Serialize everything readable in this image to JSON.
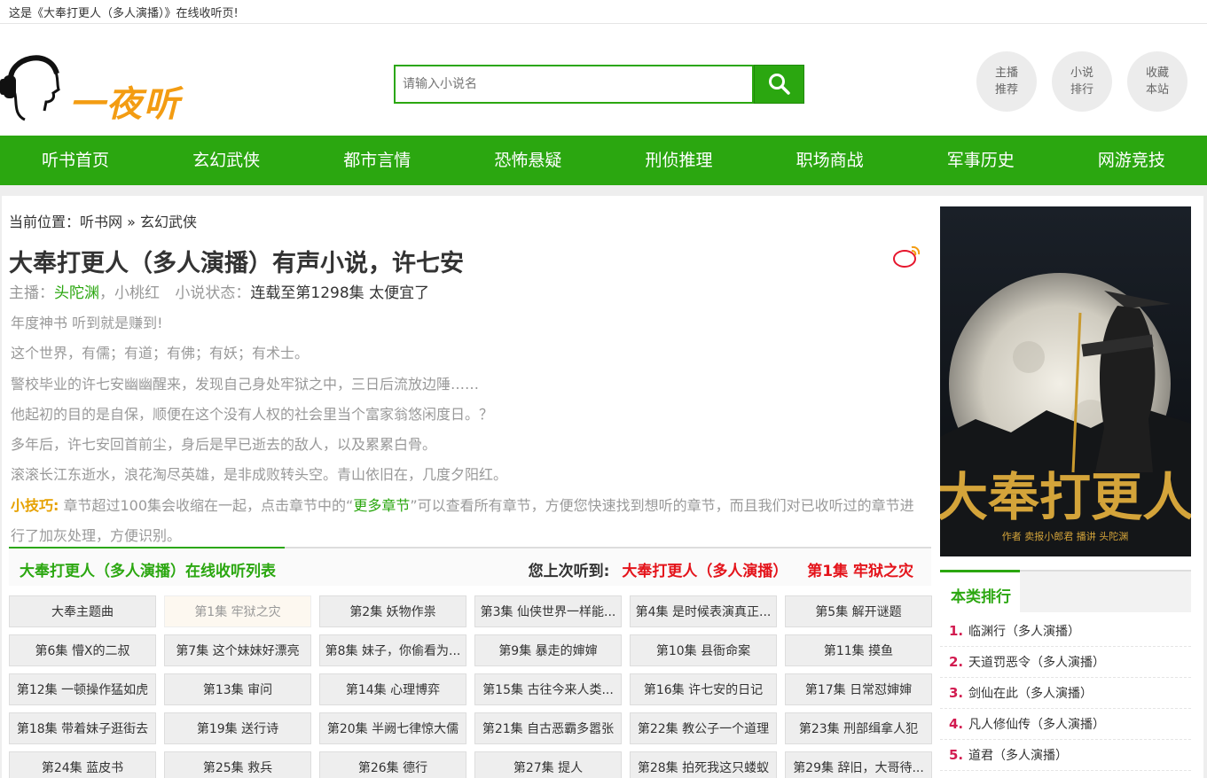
{
  "topbar": {
    "text": "这是《大奉打更人（多人演播）》在线收听页!"
  },
  "header": {
    "logo_text": "一夜听",
    "search": {
      "placeholder": "请输入小说名",
      "button_icon": "search-icon"
    },
    "circle_buttons": [
      {
        "line1": "主播",
        "line2": "推荐"
      },
      {
        "line1": "小说",
        "line2": "排行"
      },
      {
        "line1": "收藏",
        "line2": "本站"
      }
    ]
  },
  "nav": [
    "听书首页",
    "玄幻武侠",
    "都市言情",
    "恐怖悬疑",
    "刑侦推理",
    "职场商战",
    "军事历史",
    "网游竞技"
  ],
  "breadcrumb": {
    "prefix": "当前位置：",
    "home": "听书网",
    "sep": "»",
    "current": "玄幻武侠"
  },
  "book": {
    "title": "大奉打更人（多人演播）有声小说，许七安",
    "anchor_label": "主播：",
    "anchor1": "头陀渊",
    "anchor2": "，小桃红",
    "status_label": "小说状态：",
    "status_value": "连载至第1298集 太便宜了",
    "description": [
      "年度神书 听到就是赚到!",
      "这个世界，有儒；有道；有佛；有妖；有术士。",
      "警校毕业的许七安幽幽醒来，发现自己身处牢狱之中，三日后流放边陲……",
      "他起初的目的是自保，顺便在这个没有人权的社会里当个富家翁悠闲度日。？",
      "多年后，许七安回首前尘，身后是早已逝去的敌人，以及累累白骨。",
      "滚滚长江东逝水，浪花淘尽英雄，是非成败转头空。青山依旧在，几度夕阳红。"
    ],
    "tip_label": "小技巧:",
    "tip_before": " 章节超过100集会收缩在一起，点击章节中的“",
    "tip_more": "更多章节",
    "tip_after": "”可以查看所有章节，方便您快速找到想听的章节，而且我们对已收听过的章节进行了加灰处理，方便识别。"
  },
  "list": {
    "title": "大奉打更人（多人演播）在线收听列表",
    "last_label": "您上次听到:",
    "last_book": "大奉打更人（多人演播）",
    "last_episode": "第1集 牢狱之灾",
    "episodes": [
      "大奉主题曲",
      "第1集 牢狱之灾",
      "第2集 妖物作祟",
      "第3集 仙侠世界一样能...",
      "第4集 是时候表演真正...",
      "第5集 解开谜题",
      "第6集 懵X的二叔",
      "第7集 这个妹妹好漂亮",
      "第8集 妹子，你偷看为...",
      "第9集 暴走的婶婶",
      "第10集 县衙命案",
      "第11集 摸鱼",
      "第12集 一顿操作猛如虎",
      "第13集 审问",
      "第14集 心理博弈",
      "第15集 古往今来人类...",
      "第16集 许七安的日记",
      "第17集 日常怼婶婶",
      "第18集 带着妹子逛街去",
      "第19集 送行诗",
      "第20集 半阙七律惊大儒",
      "第21集 自古恶霸多嚣张",
      "第22集 教公子一个道理",
      "第23集 刑部缉拿人犯",
      "第24集 蓝皮书",
      "第25集 救兵",
      "第26集 德行",
      "第27集 提人",
      "第28集 拍死我这只蝼蚁",
      "第29集 辞旧，大哥待..."
    ],
    "visited_index": 1
  },
  "sidebar": {
    "cover_title": "大奉打更人",
    "cover_credit": "作者 卖报小郎君   播讲 头陀渊",
    "rank_title": "本类排行",
    "ranks": [
      "临渊行（多人演播）",
      "天道罚恶令（多人演播）",
      "剑仙在此（多人演播）",
      "凡人修仙传（多人演播）",
      "道君（多人演播）"
    ]
  },
  "colors": {
    "brand_green": "#2ba710",
    "accent_red": "#e4141b",
    "tip_orange": "#e6a100"
  }
}
